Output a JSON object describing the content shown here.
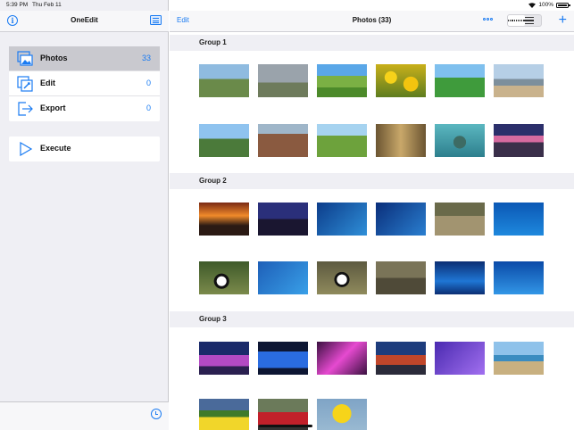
{
  "status_bar": {
    "time": "5:39 PM",
    "date": "Thu Feb 11",
    "battery": "100%"
  },
  "sidebar": {
    "title": "OneEdit",
    "items": [
      {
        "label": "Photos",
        "count": "33",
        "icon": "photos-icon",
        "selected": true
      },
      {
        "label": "Edit",
        "count": "0",
        "icon": "edit-icon",
        "selected": false
      },
      {
        "label": "Export",
        "count": "0",
        "icon": "export-icon",
        "selected": false
      }
    ],
    "execute_label": "Execute"
  },
  "main": {
    "edit_label": "Edit",
    "title": "Photos (33)",
    "view_modes": [
      "grid-icon",
      "list-icon"
    ],
    "active_view": "grid",
    "groups": [
      {
        "name": "Group 1",
        "photos": [
          "torii-gate",
          "windmill",
          "green-valley",
          "sunflower-field",
          "green-hills",
          "beach-coast",
          "mountain-village",
          "old-town-rooftops",
          "grass-hills",
          "stone-alley",
          "underwater-turtle",
          "purple-sunset"
        ]
      },
      {
        "name": "Group 2",
        "photos": [
          "orange-sunset",
          "city-dusk",
          "shark-aquarium",
          "fish-blue",
          "panda-yard",
          "dolphin-jump",
          "panda-tree",
          "dolphins-pool",
          "panda-sitting",
          "red-pandas",
          "aquarium-tunnel",
          "dolphin-show"
        ]
      },
      {
        "name": "Group 3",
        "photos": [
          "birds-nest-stadium",
          "water-cube-blue",
          "water-cube-pink",
          "china-pavilion",
          "water-cube-purple",
          "cliff-coast",
          "yellow-flowers",
          "red-train",
          "rubber-duck"
        ]
      }
    ]
  },
  "colors": {
    "accent": "#1a7bf2",
    "sidebar_bg": "#efeff4",
    "selected_bg": "#c9c9cf"
  }
}
